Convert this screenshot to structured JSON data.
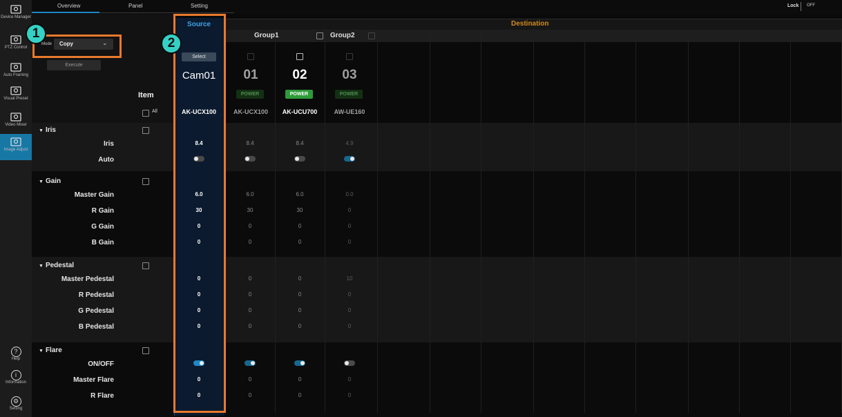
{
  "rail": {
    "items": [
      {
        "label": "Device Manager",
        "icon": "device-manager-icon"
      },
      {
        "label": "PTZ Control",
        "icon": "ptz-control-icon"
      },
      {
        "label": "Auto Framing",
        "icon": "auto-framing-icon"
      },
      {
        "label": "Visual Preset",
        "icon": "visual-preset-icon"
      },
      {
        "label": "Video Mixer",
        "icon": "video-mixer-icon"
      },
      {
        "label": "Image Adjust",
        "icon": "image-adjust-icon"
      }
    ],
    "bottom": [
      {
        "label": "Help",
        "icon": "help-icon"
      },
      {
        "label": "Information",
        "icon": "information-icon"
      },
      {
        "label": "Setting",
        "icon": "setting-icon"
      }
    ]
  },
  "tabs": [
    "Overview",
    "Panel",
    "Setting"
  ],
  "lock": {
    "label": "Lock",
    "state": "OFF"
  },
  "mode": {
    "label": "Mode",
    "value": "Copy"
  },
  "execute_label": "Execute",
  "item_header": "Item",
  "all_label": "All",
  "source": {
    "header": "Source",
    "select_label": "Select",
    "cam": "Cam01",
    "model": "AK-UCX100"
  },
  "destination": {
    "header": "Destination",
    "groups": [
      "Group1",
      "Group2"
    ]
  },
  "cameras": [
    {
      "num": "01",
      "power": "POWER",
      "on": false,
      "model": "AK-UCX100"
    },
    {
      "num": "02",
      "power": "POWER",
      "on": true,
      "model": "AK-UCU700"
    },
    {
      "num": "03",
      "power": "POWER",
      "on": false,
      "model": "AW-UE160"
    }
  ],
  "callouts": [
    "1",
    "2"
  ],
  "sections": [
    {
      "name": "Iris",
      "rows": [
        {
          "label": "Iris",
          "source": "8.4",
          "dest": [
            "8.4",
            "8.4",
            "4.9"
          ]
        },
        {
          "label": "Auto",
          "toggle": true,
          "source": "off",
          "dest": [
            "off",
            "off",
            "on"
          ]
        }
      ]
    },
    {
      "name": "Gain",
      "rows": [
        {
          "label": "Master Gain",
          "source": "6.0",
          "dest": [
            "6.0",
            "6.0",
            "0.0"
          ]
        },
        {
          "label": "R Gain",
          "source": "30",
          "dest": [
            "30",
            "30",
            "0"
          ]
        },
        {
          "label": "G Gain",
          "source": "0",
          "dest": [
            "0",
            "0",
            "0"
          ]
        },
        {
          "label": "B Gain",
          "source": "0",
          "dest": [
            "0",
            "0",
            "0"
          ]
        }
      ]
    },
    {
      "name": "Pedestal",
      "rows": [
        {
          "label": "Master Pedestal",
          "source": "0",
          "dest": [
            "0",
            "0",
            "10"
          ]
        },
        {
          "label": "R Pedestal",
          "source": "0",
          "dest": [
            "0",
            "0",
            "0"
          ]
        },
        {
          "label": "G Pedestal",
          "source": "0",
          "dest": [
            "0",
            "0",
            "0"
          ]
        },
        {
          "label": "B Pedestal",
          "source": "0",
          "dest": [
            "0",
            "0",
            "0"
          ]
        }
      ]
    },
    {
      "name": "Flare",
      "rows": [
        {
          "label": "ON/OFF",
          "toggle": true,
          "source": "on",
          "dest": [
            "on",
            "on",
            "off"
          ]
        },
        {
          "label": "Master Flare",
          "source": "0",
          "dest": [
            "0",
            "0",
            "0"
          ]
        },
        {
          "label": "R Flare",
          "source": "0",
          "dest": [
            "0",
            "0",
            "0"
          ]
        }
      ]
    }
  ],
  "colors": {
    "accent": "#1e88c8",
    "highlight": "#ea7a2c",
    "destination_header": "#d18b1f",
    "power_on": "#2e9b3a",
    "callout": "#35d1c5"
  }
}
